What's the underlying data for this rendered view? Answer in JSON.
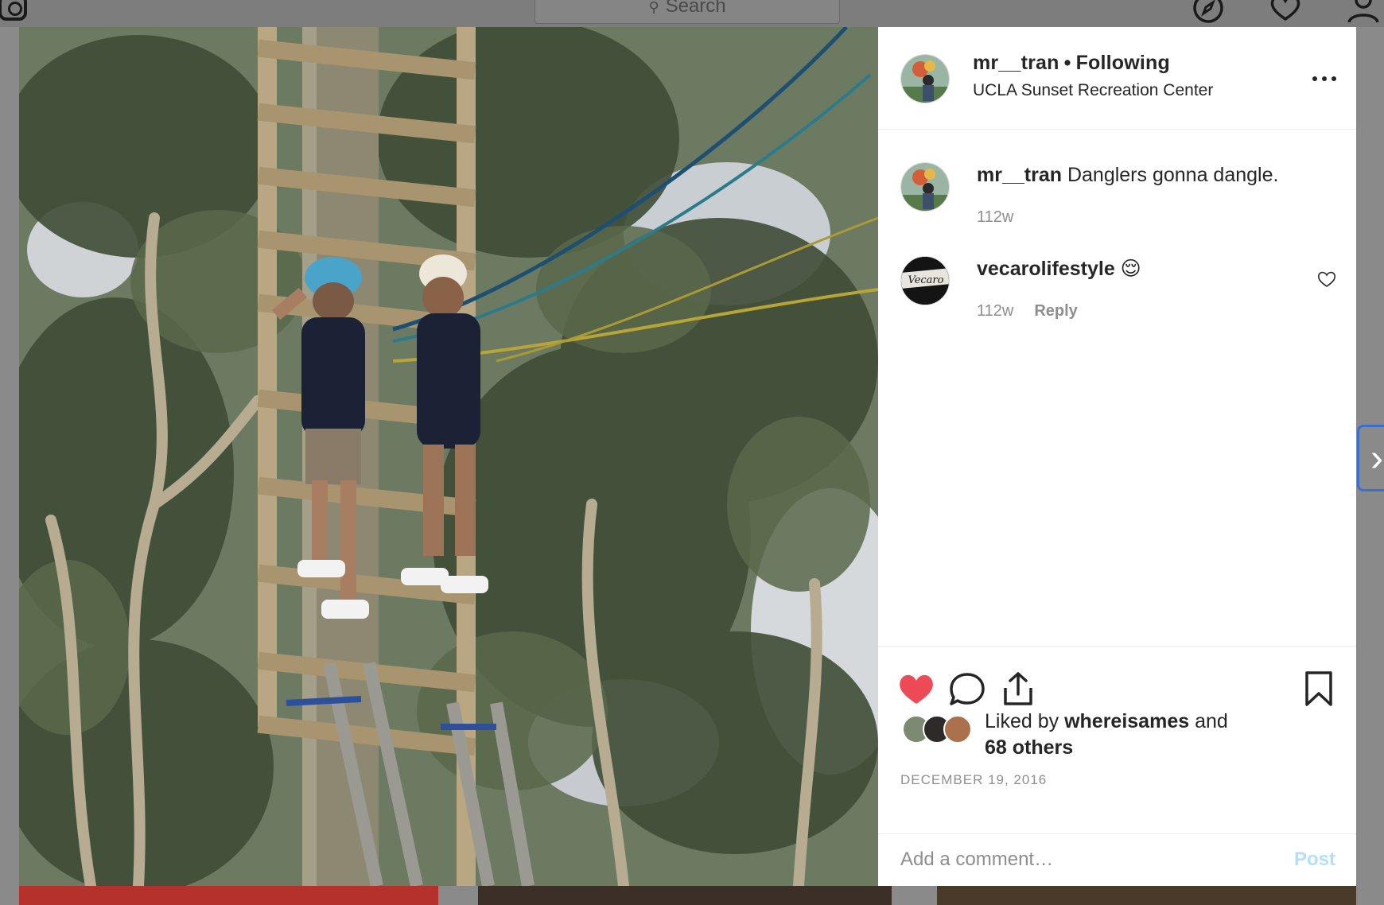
{
  "topbar": {
    "search_placeholder": "Search",
    "icons": [
      "camera-logo-icon",
      "compass-icon",
      "heart-icon",
      "profile-icon"
    ]
  },
  "post": {
    "author": "mr__tran",
    "separator": "•",
    "follow_status": "Following",
    "location": "UCLA Sunset Recreation Center",
    "caption_user": "mr__tran",
    "caption_text": "Danglers gonna dangle.",
    "caption_age": "112w",
    "comments": [
      {
        "user": "vecarolifestyle",
        "text": "😌",
        "age": "112w",
        "reply_label": "Reply",
        "avatar_text": "Vecaro"
      }
    ],
    "liked_by_prefix": "Liked by",
    "liked_by_user": "whereisames",
    "liked_by_and": "and",
    "liked_by_others": "68 others",
    "date": "DECEMBER 19, 2016",
    "comment_placeholder": "Add a comment…",
    "post_label": "Post",
    "liked": true
  },
  "colors": {
    "like_red": "#ed4956",
    "post_disabled_blue": "#b2dffc",
    "secondary_text": "#8e8e8e"
  },
  "navigation": {
    "next_arrow": "›"
  }
}
